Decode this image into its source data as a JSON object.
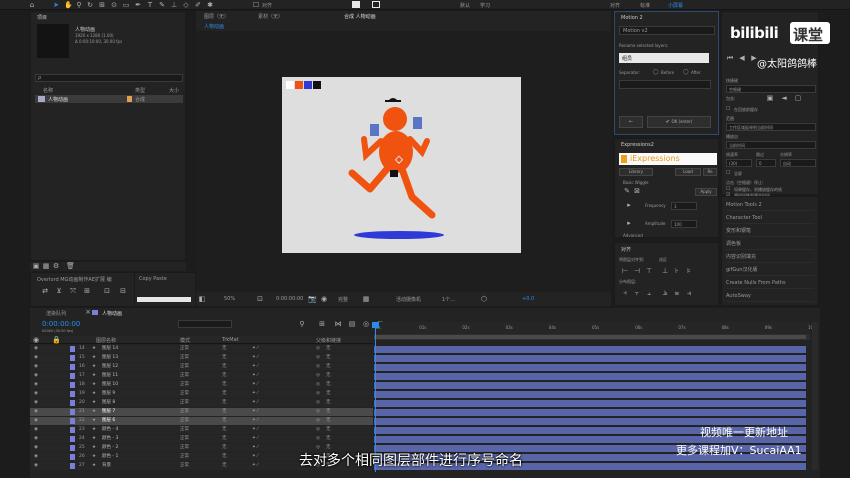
{
  "colors": {
    "accent_blue": "#2d8ceb",
    "track_bar": "#5865a8",
    "character_orange": "#f0530f",
    "shadow_blue": "#2e39d8",
    "comp_bg": "#dedede",
    "label_violet": "#7b7fd6"
  },
  "menubar": {
    "items": [
      "对齐",
      "默认",
      "学习",
      "标准",
      "小屏幕"
    ]
  },
  "toolbar": {
    "snap_label": "对齐"
  },
  "project_panel": {
    "title": "项目",
    "comp_name": "人物动画",
    "comp_size": "1920 x 1280 (1.00)",
    "comp_duration": "Δ 0:00:10:00, 30.00 fps",
    "search_placeholder": "ρ",
    "column_name": "名称",
    "column_type": "类型",
    "column_size": "大小",
    "items": [
      {
        "name": "人物动画",
        "type": "合成"
      }
    ],
    "bpc": "16 bpc"
  },
  "viewer_tabs": {
    "footage": "图层（无）",
    "material": "素材（无）",
    "comp_tab": "合成 人物动画",
    "comp_breadcrumb": "人物动画"
  },
  "viewer_bar": {
    "zoom": "50%",
    "time": "0:00:00:00",
    "quality": "完整",
    "camera": "活动摄像机",
    "views": "1个...",
    "exposure": "+0.0"
  },
  "motion_panel": {
    "title": "Motion 2",
    "tab": "Motion v2",
    "rename_label": "Rename selected layers:",
    "rename_value": "组员",
    "separator_label": "Separator:",
    "before": "Before",
    "after": "After",
    "ok_label": "OK (enter)"
  },
  "expressions_panel": {
    "title": "Expressions2",
    "logo": "iExpressions",
    "tab_library": "Library",
    "tab_load": "Load",
    "tab_more": "Re",
    "preset": "Basic Wiggle",
    "apply": "Apply",
    "frequency_label": "Frequency",
    "frequency_value": "3",
    "amplitude_label": "Amplitude",
    "amplitude_value": "100",
    "advanced": "Advanced"
  },
  "align_panel": {
    "title": "对齐",
    "align_to_label": "将图层对齐到:",
    "align_to_value": "选区",
    "distribute_label": "分布图层:"
  },
  "preview_panel": {
    "shortcut_label": "快捷键",
    "shortcut_value": "空格键",
    "include_label": "包含:",
    "cache_check": "在回放前缓存",
    "range_label": "范围",
    "range_value": "工作区域延伸到当前时间",
    "playfrom_label": "播放自",
    "playfrom_value": "当前时间",
    "fps_label": "帧速率",
    "skip_label": "跳过",
    "res_label": "分辨率",
    "fps_value": "(30)",
    "skip_value": "0",
    "res_value": "自动",
    "fullscreen": "全屏",
    "stop_label": "点击（空格键）停止:",
    "stop_opt1": "如果缓存，则播放缓存的帧",
    "stop_opt2": "将时间移到预览时间"
  },
  "scripts_panel": {
    "items": [
      "Motion Tools 2",
      "Character Tool",
      "变形和钢笔",
      "调色板",
      "内容识别填充",
      "gifGun汉化版",
      "Create Nulls From Paths",
      "AutoSway"
    ]
  },
  "effects_row": {
    "tab1": "Overlord MG动画制作AE扩展 编",
    "tab2": "Copy Paste"
  },
  "timeline": {
    "queue_tab": "渲染队列",
    "comp_tab": "人物动画",
    "timecode": "0:00:00:00",
    "timecode_sub": "00000 (30.00 fps)",
    "col_layer": "图层名称",
    "col_mode": "模式",
    "col_trkmat": "TrkMat",
    "col_parent": "父级和链接",
    "ruler": [
      "0s",
      "01s",
      "02s",
      "03s",
      "04s",
      "05s",
      "06s",
      "07s",
      "08s",
      "09s",
      "10s"
    ],
    "layers": [
      {
        "num": "14",
        "name": "图层 14",
        "mode": "正常",
        "trk": "无",
        "parent": "无",
        "selected": false
      },
      {
        "num": "15",
        "name": "图层 13",
        "mode": "正常",
        "trk": "无",
        "parent": "无",
        "selected": false
      },
      {
        "num": "16",
        "name": "图层 12",
        "mode": "正常",
        "trk": "无",
        "parent": "无",
        "selected": false
      },
      {
        "num": "17",
        "name": "图层 11",
        "mode": "正常",
        "trk": "无",
        "parent": "无",
        "selected": false
      },
      {
        "num": "18",
        "name": "图层 10",
        "mode": "正常",
        "trk": "无",
        "parent": "无",
        "selected": false
      },
      {
        "num": "19",
        "name": "图层 9",
        "mode": "正常",
        "trk": "无",
        "parent": "无",
        "selected": false
      },
      {
        "num": "20",
        "name": "图层 8",
        "mode": "正常",
        "trk": "无",
        "parent": "无",
        "selected": false
      },
      {
        "num": "21",
        "name": "图层 7",
        "mode": "正常",
        "trk": "无",
        "parent": "无",
        "selected": true
      },
      {
        "num": "22",
        "name": "图层 6",
        "mode": "正常",
        "trk": "无",
        "parent": "无",
        "selected": true
      },
      {
        "num": "23",
        "name": "颜色 - 4",
        "mode": "正常",
        "trk": "无",
        "parent": "无",
        "selected": false
      },
      {
        "num": "24",
        "name": "颜色 - 3",
        "mode": "正常",
        "trk": "无",
        "parent": "无",
        "selected": false
      },
      {
        "num": "25",
        "name": "颜色 - 2",
        "mode": "正常",
        "trk": "无",
        "parent": "无",
        "selected": false
      },
      {
        "num": "26",
        "name": "颜色 - 1",
        "mode": "正常",
        "trk": "无",
        "parent": "无",
        "selected": false
      },
      {
        "num": "27",
        "name": "背景",
        "mode": "正常",
        "trk": "无",
        "parent": "无",
        "selected": false
      }
    ]
  },
  "overlay": {
    "logo_text": "bilibili",
    "logo_box": "课堂",
    "watermark": "@太阳鸽鸽棒",
    "notice1": "视频唯一更新地址",
    "notice2": "更多课程加V：SucaiAA1",
    "subtitle": "去对多个相同图层部件进行序号命名"
  }
}
